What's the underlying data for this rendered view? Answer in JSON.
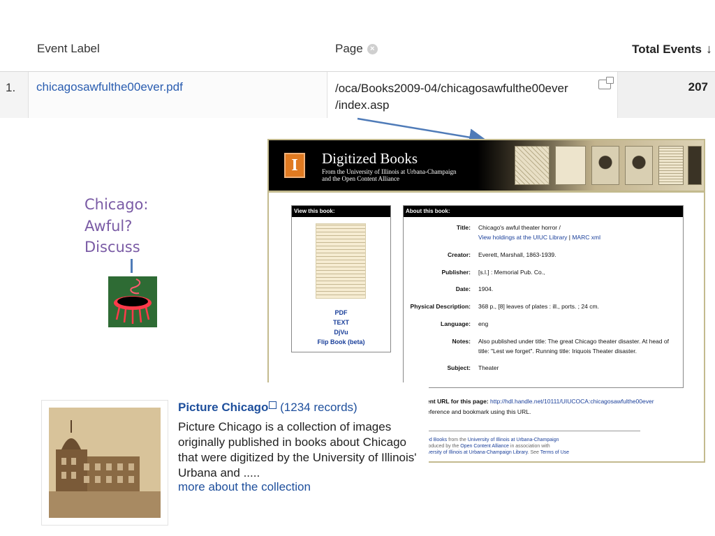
{
  "analytics": {
    "columns": {
      "event_label": "Event Label",
      "page": "Page",
      "total_events": "Total Events"
    },
    "row": {
      "rank": "1.",
      "event_label": "chicagosawfulthe00ever.pdf",
      "page_line1": "/oca/Books2009-04/chicagosawfulthe00ever",
      "page_line2": "/index.asp",
      "total": "207"
    }
  },
  "caption": {
    "line1": "Chicago:",
    "line2": "Awful?",
    "line3": "Discuss"
  },
  "digitized_books": {
    "logo": "I",
    "title": "Digitized Books",
    "subtitle_line1": "From the University of Illinois at Urbana-Champaign",
    "subtitle_line2": "and the Open Content Alliance",
    "view_box": {
      "heading": "View this book:",
      "links": [
        "PDF",
        "TEXT",
        "DjVu",
        "Flip Book (beta)"
      ]
    },
    "about_box": {
      "heading": "About this book:",
      "title_label": "Title:",
      "title_value": "Chicago's awful theater horror /",
      "holdings_link": "View holdings at the UIUC Library",
      "separator": " | ",
      "marc_link": "MARC xml",
      "creator_label": "Creator:",
      "creator_value": "Everett, Marshall, 1863-1939.",
      "publisher_label": "Publisher:",
      "publisher_value": "[s.l.] : Memorial Pub. Co.,",
      "date_label": "Date:",
      "date_value": "1904.",
      "physical_label": "Physical Description:",
      "physical_value": "368 p., [8] leaves of plates : ill., ports. ; 24 cm.",
      "language_label": "Language:",
      "language_value": "eng",
      "notes_label": "Notes:",
      "notes_value": "Also published under title: The great Chicago theater disaster. At head of title: \"Lest we forget\". Running title: Iriquois Theater disaster.",
      "subject_label": "Subject:",
      "subject_value": "Theater"
    },
    "footer": {
      "url_label": "ent URL for this page:",
      "url_value": "http://hdl.handle.net/10111/UIUCOCA:chicagosawfulthe00ever",
      "bookmark_text": "eference and bookmark using this URL."
    },
    "credits": {
      "line1_link": "ed Books",
      "line1_mid": " from the ",
      "line1_link2": "University of Illinois at Urbana-Champaign",
      "line2_pre": "roduced by the ",
      "line2_link": "Open Content Alliance",
      "line2_post": " in association with",
      "line3_link": "iversity of Illinois at Urbana-Champaign Library",
      "line3_mid": ". See ",
      "line3_link2": "Terms of Use"
    }
  },
  "picture_chicago": {
    "title": "Picture Chicago",
    "count": " (1234 records)",
    "description": "Picture Chicago is a collection of images originally published in books about Chicago that were digitized by the University of Illinois' Urbana and .....",
    "more_link": "more about the collection"
  },
  "colors": {
    "link_blue": "#2a5db0",
    "caption_purple": "#7a5ba5",
    "arrow_blue": "#4f7bb8",
    "illinois_orange": "#e07a21",
    "panel_gold": "#c3ba8e"
  }
}
